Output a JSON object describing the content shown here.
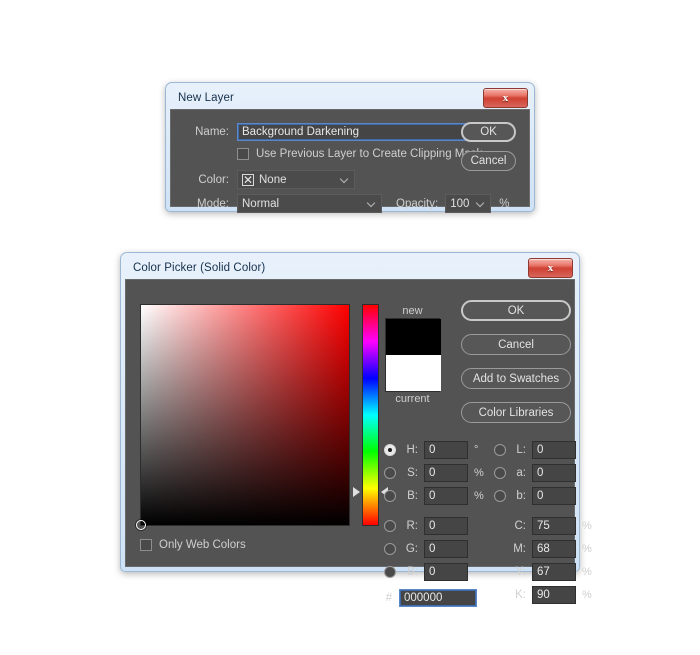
{
  "new_layer_dialog": {
    "title": "New Layer",
    "close_label": "x",
    "name_label": "Name:",
    "name_value": "Background Darkening",
    "clipping_mask_label": "Use Previous Layer to Create Clipping Mask",
    "color_label": "Color:",
    "color_value": "None",
    "color_swatch_glyph": "☒",
    "mode_label": "Mode:",
    "mode_value": "Normal",
    "opacity_label": "Opacity:",
    "opacity_value": "100",
    "opacity_unit": "%",
    "ok_label": "OK",
    "cancel_label": "Cancel"
  },
  "color_picker_dialog": {
    "title": "Color Picker (Solid Color)",
    "close_label": "x",
    "new_label": "new",
    "current_label": "current",
    "new_color": "#000000",
    "current_color": "#ffffff",
    "buttons": {
      "ok": "OK",
      "cancel": "Cancel",
      "add_to_swatches": "Add to Swatches",
      "color_libraries": "Color Libraries"
    },
    "only_web_colors_label": "Only Web Colors",
    "only_web_colors_checked": false,
    "hsb": [
      {
        "key": "H:",
        "value": "0",
        "unit": "°",
        "selected": true
      },
      {
        "key": "S:",
        "value": "0",
        "unit": "%",
        "selected": false
      },
      {
        "key": "B:",
        "value": "0",
        "unit": "%",
        "selected": false
      }
    ],
    "rgb": [
      {
        "key": "R:",
        "value": "0",
        "unit": "",
        "selected": false
      },
      {
        "key": "G:",
        "value": "0",
        "unit": "",
        "selected": false
      },
      {
        "key": "B:",
        "value": "0",
        "unit": "",
        "selected": false
      }
    ],
    "lab": [
      {
        "key": "L:",
        "value": "0",
        "unit": "",
        "selected": false
      },
      {
        "key": "a:",
        "value": "0",
        "unit": "",
        "selected": false
      },
      {
        "key": "b:",
        "value": "0",
        "unit": "",
        "selected": false
      }
    ],
    "cmyk": [
      {
        "key": "C:",
        "value": "75",
        "unit": "%"
      },
      {
        "key": "M:",
        "value": "68",
        "unit": "%"
      },
      {
        "key": "Y:",
        "value": "67",
        "unit": "%"
      },
      {
        "key": "K:",
        "value": "90",
        "unit": "%"
      }
    ],
    "hex_prefix": "#",
    "hex_value": "000000"
  },
  "theme": {
    "panel_bg": "#535353",
    "field_bg": "#454545",
    "accent_focus": "#5a87c5",
    "titlebar_start": "#e8f1fb",
    "close_red": "#cf4133"
  }
}
